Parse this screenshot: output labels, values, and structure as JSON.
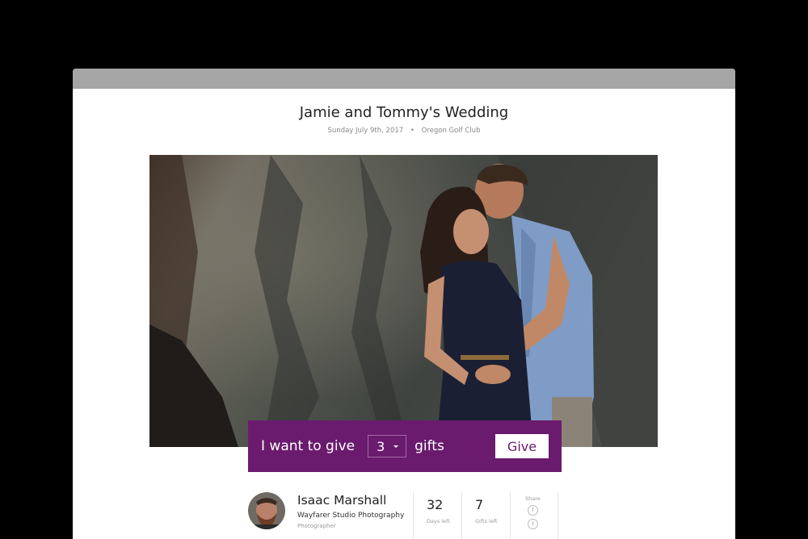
{
  "event": {
    "title": "Jamie and Tommy's Wedding",
    "date": "Sunday July 9th, 2017",
    "separator": "•",
    "venue": "Oregon Golf Club"
  },
  "photo": {
    "alt": "Couple embracing in front of a rocky cliff"
  },
  "give": {
    "label": "I want to give",
    "quantity": "3",
    "unit": "gifts",
    "button": "Give",
    "accent": "#6a1b6e"
  },
  "photographer": {
    "name": "Isaac Marshall",
    "studio": "Wayfarer Studio Photography",
    "role": "Photographer"
  },
  "stats": [
    {
      "value": "32",
      "label": "Days left"
    },
    {
      "value": "7",
      "label": "Gifts left"
    }
  ],
  "share": {
    "label": "Share",
    "icons": [
      {
        "name": "facebook-icon",
        "glyph": "f"
      },
      {
        "name": "twitter-icon",
        "glyph": "t"
      }
    ]
  }
}
